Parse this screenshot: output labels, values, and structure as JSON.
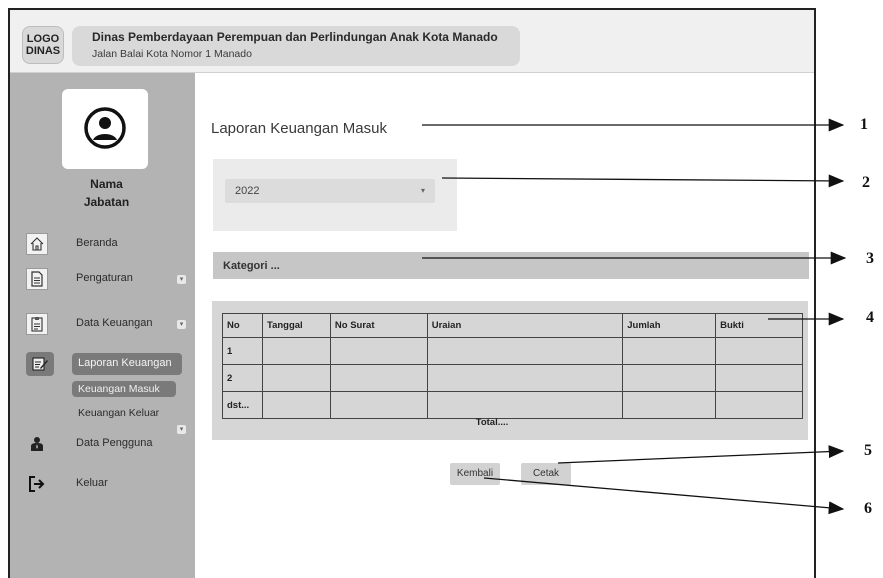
{
  "header": {
    "logo_line1": "LOGO",
    "logo_line2": "DINAS",
    "org_name": "Dinas Pemberdayaan Perempuan dan Perlindungan Anak Kota Manado",
    "org_address": "Jalan Balai Kota Nomor 1 Manado"
  },
  "profile": {
    "name": "Nama",
    "role": "Jabatan"
  },
  "sidebar": {
    "items": [
      {
        "label": "Beranda",
        "icon": "home-icon"
      },
      {
        "label": "Pengaturan",
        "icon": "document-icon"
      },
      {
        "label": "Data Keuangan",
        "icon": "clipboard-icon"
      },
      {
        "label": "Laporan Keuangan",
        "icon": "edit-report-icon"
      },
      {
        "label": "Data Pengguna",
        "icon": "user-icon"
      },
      {
        "label": "Keluar",
        "icon": "logout-icon"
      }
    ],
    "sub_items": [
      "Keuangan Masuk",
      "Keuangan Keluar"
    ]
  },
  "main": {
    "title": "Laporan Keuangan Masuk",
    "year_select": "2022",
    "category": "Kategori ...",
    "table": {
      "headers": [
        "No",
        "Tanggal",
        "No Surat",
        "Uraian",
        "Jumlah",
        "Bukti"
      ],
      "rows": [
        [
          "1",
          "",
          "",
          "",
          "",
          ""
        ],
        [
          "2",
          "",
          "",
          "",
          "",
          ""
        ],
        [
          "dst...",
          "",
          "",
          "",
          "",
          ""
        ]
      ],
      "total_label": "Total...."
    },
    "buttons": {
      "back": "Kembali",
      "print": "Cetak"
    }
  },
  "callouts": [
    "1",
    "2",
    "3",
    "4",
    "5",
    "6"
  ],
  "colors": {
    "sidebar_bg": "#b3b3b3",
    "active_item": "#7a7a7a",
    "panel_bg": "#d6d6d6",
    "header_bg": "#f0f0f0"
  }
}
